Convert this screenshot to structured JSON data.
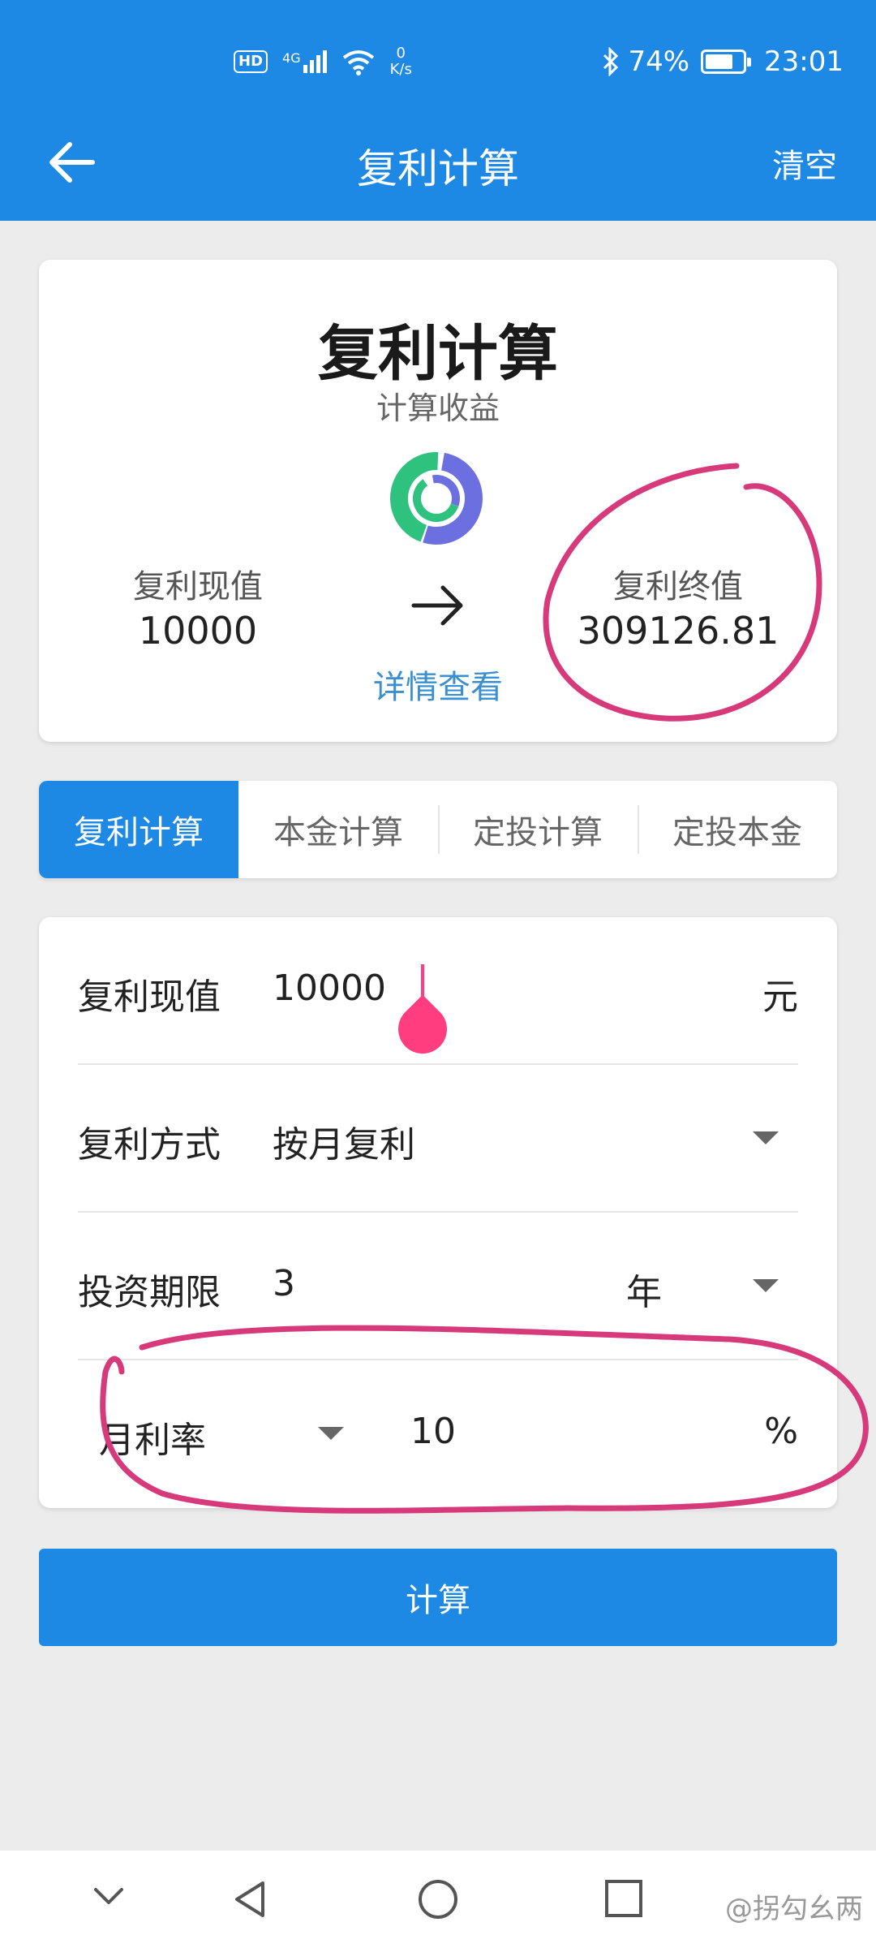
{
  "status_bar": {
    "hd": "HD",
    "network": "4G",
    "speed_value": "0",
    "speed_unit": "K/s",
    "battery_percent": "74%",
    "battery_level": 0.74,
    "time": "23:01"
  },
  "app_bar": {
    "title": "复利计算",
    "clear_label": "清空"
  },
  "summary": {
    "title": "复利计算",
    "subtitle": "计算收益",
    "present_value_label": "复利现值",
    "present_value": "10000",
    "future_value_label": "复利终值",
    "future_value": "309126.81",
    "detail_link": "详情查看"
  },
  "tabs": [
    {
      "label": "复利计算",
      "active": true
    },
    {
      "label": "本金计算",
      "active": false
    },
    {
      "label": "定投计算",
      "active": false
    },
    {
      "label": "定投本金",
      "active": false
    }
  ],
  "form": {
    "present_value": {
      "label": "复利现值",
      "value": "10000",
      "unit": "元"
    },
    "compound_method": {
      "label": "复利方式",
      "value": "按月复利"
    },
    "term": {
      "label": "投资期限",
      "value": "3",
      "unit": "年"
    },
    "rate": {
      "label": "月利率",
      "value": "10",
      "unit": "%"
    }
  },
  "compute_button": "计算",
  "watermark": "@拐勾幺两",
  "colors": {
    "primary": "#1e88e5",
    "link": "#3a8fd0",
    "cursor": "#ff3d7f",
    "annotation": "#d63a7a",
    "donut_green": "#2ec27e",
    "donut_purple": "#6b6fe0"
  }
}
